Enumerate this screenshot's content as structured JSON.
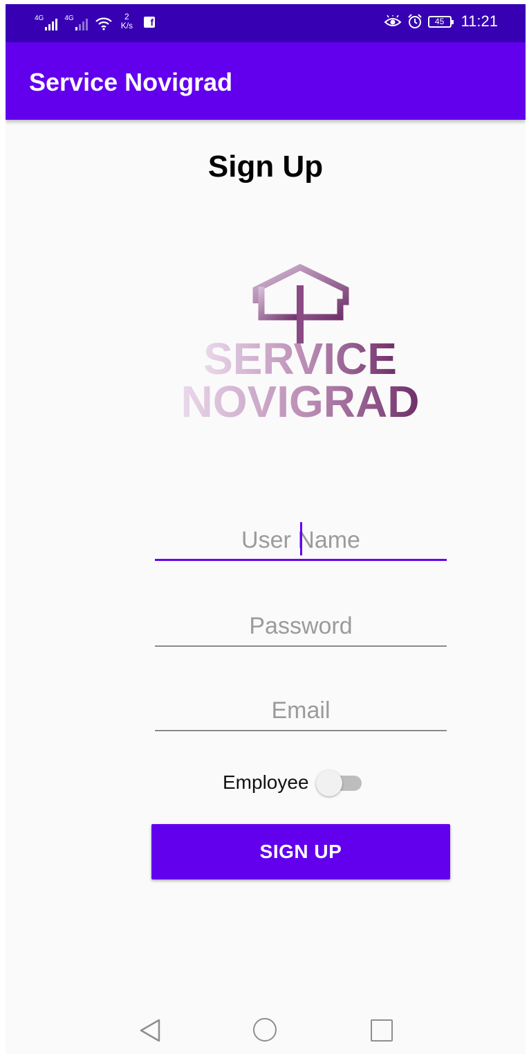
{
  "status_bar": {
    "network_1": "4G",
    "network_2": "4G",
    "speed_value": "2",
    "speed_unit": "K/s",
    "battery": "45",
    "time": "11:21",
    "icons": [
      "signal-icon",
      "wifi-icon",
      "facebook-icon",
      "eye-comfort-icon",
      "alarm-icon",
      "battery-icon"
    ]
  },
  "app_bar": {
    "title": "Service Novigrad"
  },
  "page": {
    "heading": "Sign Up"
  },
  "logo": {
    "line1": "SERVICE",
    "line2": "NOVIGRAD",
    "colors": [
      "#d9c2da",
      "#7b3a75"
    ]
  },
  "form": {
    "username": {
      "placeholder": "User Name",
      "value": ""
    },
    "password": {
      "placeholder": "Password",
      "value": ""
    },
    "email": {
      "placeholder": "Email",
      "value": ""
    },
    "employee_switch": {
      "label": "Employee",
      "checked": false
    },
    "submit_label": "SIGN UP"
  },
  "colors": {
    "primary": "#6200ee",
    "primary_dark": "#3700b3",
    "background": "#fafafa"
  },
  "nav_bar": {
    "icons": [
      "back-icon",
      "home-icon",
      "recents-icon"
    ]
  }
}
